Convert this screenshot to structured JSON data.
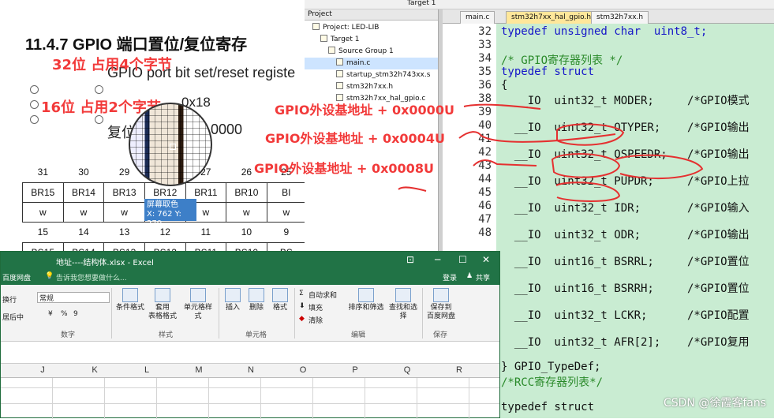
{
  "document": {
    "section_title": "11.4.7      GPIO 端口置位/复位寄存",
    "subtitle": "GPIO port bit set/reset registe",
    "offset_label": "0x18",
    "reset_label": "复位",
    "reset_value": "0 0000",
    "bit_numbers": [
      "31",
      "30",
      "29",
      "28",
      "27",
      "26",
      "25"
    ],
    "bit_names": [
      "BR15",
      "BR14",
      "BR13",
      "BR12",
      "BR11",
      "BR10",
      "BI"
    ],
    "access": [
      "w",
      "w",
      "w",
      "w",
      "w",
      "w",
      "w"
    ],
    "bit_numbers_2": [
      "15",
      "14",
      "13",
      "12",
      "11",
      "10",
      "9"
    ],
    "bit_names_2": [
      "BS15",
      "BS14",
      "BS13",
      "BS12",
      "BS11",
      "BS10",
      "BS"
    ],
    "pixel_tip": "屏幕取色",
    "pixel_coord": "X: 762  Y: 270"
  },
  "annotations": {
    "a1": "32位 占用4个字节",
    "a2": "16位 占用2个字节",
    "a3": "GPIO外设基地址 + 0x0000U",
    "a4": "GPIO外设基地址 + 0x0004U",
    "a5": "GPIO外设基地址 + 0x0008U",
    "color": "#f23a3a"
  },
  "ide": {
    "target": "Target 1",
    "project_header": "Project",
    "tree": [
      {
        "label": "Project: LED-LIB",
        "indent": 1
      },
      {
        "label": "Target 1",
        "indent": 2
      },
      {
        "label": "Source Group 1",
        "indent": 3
      },
      {
        "label": "main.c",
        "indent": 4,
        "selected": true
      },
      {
        "label": "startup_stm32h743xx.s",
        "indent": 4
      },
      {
        "label": "stm32h7xx.h",
        "indent": 4
      },
      {
        "label": "stm32h7xx_hal_gpio.c",
        "indent": 4
      }
    ],
    "tabs": [
      "main.c",
      "stm32h7xx_hal_gpio.h",
      "stm32h7xx.h"
    ],
    "active_tab": 1,
    "code_bg": "#c9ecd2"
  },
  "code": [
    {
      "n": "32",
      "t": "typedef unsigned char  uint8_t;",
      "k": "kw"
    },
    {
      "n": "33",
      "t": ""
    },
    {
      "n": "34",
      "t": "/* GPIO寄存器列表 */",
      "k": "cm"
    },
    {
      "n": "35",
      "t": "typedef struct",
      "k": "kw"
    },
    {
      "n": "36",
      "t": "{"
    },
    {
      "n": "38",
      "t": "  __IO  uint32_t MODER;     /*GPIO模式"
    },
    {
      "n": "39",
      "t": ""
    },
    {
      "n": "40",
      "t": "  __IO  uint32_t OTYPER;    /*GPIO输出"
    },
    {
      "n": "41",
      "t": ""
    },
    {
      "n": "42",
      "t": "  __IO  uint32_t OSPEEDR;   /*GPIO输出"
    },
    {
      "n": "43",
      "t": ""
    },
    {
      "n": "44",
      "t": "  __IO  uint32_t PUPDR;     /*GPIO上拉"
    },
    {
      "n": "45",
      "t": ""
    },
    {
      "n": "46",
      "t": "  __IO  uint32_t IDR;       /*GPIO输入"
    },
    {
      "n": "47",
      "t": ""
    },
    {
      "n": "48",
      "t": "  __IO  uint32_t ODR;       /*GPIO输出"
    },
    {
      "n": "",
      "t": ""
    },
    {
      "n": "",
      "t": "  __IO  uint16_t BSRRL;     /*GPIO置位"
    },
    {
      "n": "",
      "t": ""
    },
    {
      "n": "",
      "t": "  __IO  uint16_t BSRRH;     /*GPIO置位"
    },
    {
      "n": "",
      "t": ""
    },
    {
      "n": "",
      "t": "  __IO  uint32_t LCKR;      /*GPIO配置"
    },
    {
      "n": "",
      "t": ""
    },
    {
      "n": "",
      "t": "  __IO  uint32_t AFR[2];    /*GPIO复用"
    },
    {
      "n": "",
      "t": ""
    },
    {
      "n": "",
      "t": "} GPIO_TypeDef;"
    },
    {
      "n": "",
      "t": "/*RCC寄存器列表*/",
      "k": "cm"
    },
    {
      "n": "",
      "t": ""
    },
    {
      "n": "",
      "t": "typedef struct"
    }
  ],
  "excel": {
    "title": "地址----结构体.xlsx  -  Excel",
    "menu_left": "百度网盘",
    "tell_me": "告诉我您想要做什么...",
    "login": "登录",
    "share": "共享",
    "wrap": "换行",
    "merge": "居后中",
    "number_format": "常规",
    "pct": "%",
    "comma": "9",
    "group_number": "数字",
    "cond_format": "条件格式",
    "table_format": "套用\n表格格式",
    "cell_style": "单元格样式",
    "group_style": "样式",
    "insert": "插入",
    "delete": "删除",
    "format": "格式",
    "group_cells": "单元格",
    "autosum": "自动求和",
    "fill": "填充",
    "clear": "清除",
    "sort_filter": "排序和筛选",
    "find_select": "查找和选择",
    "group_edit": "编辑",
    "save_baidu": "保存到\n百度网盘",
    "group_save": "保存",
    "columns": [
      "J",
      "K",
      "L",
      "M",
      "N",
      "O",
      "P",
      "Q",
      "R"
    ]
  },
  "watermark": "CSDN @徐霞客fans"
}
